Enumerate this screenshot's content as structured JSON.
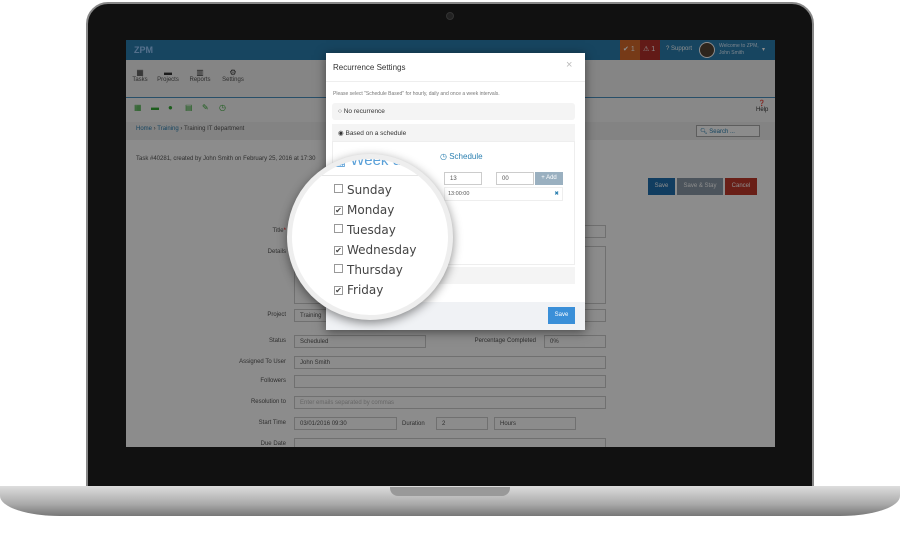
{
  "app": {
    "logo": "ZPM",
    "support": "Support",
    "welcome": "Welcome to ZPM,",
    "user": "John Smith",
    "badge1": "1",
    "badge2": "1"
  },
  "nav": [
    {
      "label": "Tasks",
      "icon": "calendar-icon"
    },
    {
      "label": "Projects",
      "icon": "folder-icon"
    },
    {
      "label": "Reports",
      "icon": "bar-chart-icon"
    },
    {
      "label": "Settings",
      "icon": "gear-icon"
    }
  ],
  "help": "Help",
  "breadcrumb": {
    "home": "Home",
    "training": "Training",
    "current": "Training IT department"
  },
  "search_placeholder": "Search ...",
  "task_info": "Task #40281, created by John Smith on February 25, 2016 at 17:30",
  "buttons": {
    "save": "Save",
    "save_stay": "Save & Stay",
    "cancel": "Cancel"
  },
  "form": {
    "title": "Title",
    "details": "Details",
    "project": "Project",
    "project_value": "Training",
    "status": "Status",
    "status_value": "Scheduled",
    "pct": "Percentage Completed",
    "pct_value": "0%",
    "assigned": "Assigned To User",
    "assigned_value": "John Smith",
    "followers": "Followers",
    "resolution": "Resolution to",
    "resolution_placeholder": "Enter emails separated by commas",
    "start": "Start Time",
    "start_value": "03/01/2016 09:30",
    "duration": "Duration",
    "duration_value": "2",
    "unit": "Hours",
    "due": "Due Date"
  },
  "modal": {
    "title": "Recurrence Settings",
    "hint": "Please select \"Schedule Based\" for hourly, daily and once a week intervals.",
    "opt_none": "No recurrence",
    "opt_schedule": "Based on a schedule",
    "weekdays": "Week days",
    "schedule": "Schedule",
    "hour": "13",
    "minute": "00",
    "add": "+ Add",
    "time_entry": "13:00:00",
    "save": "Save",
    "days": [
      {
        "label": "Sunday",
        "checked": false
      },
      {
        "label": "Monday",
        "checked": true
      },
      {
        "label": "Tuesday",
        "checked": false
      },
      {
        "label": "Wednesday",
        "checked": true
      },
      {
        "label": "Thursday",
        "checked": false
      },
      {
        "label": "Friday",
        "checked": true
      }
    ]
  }
}
